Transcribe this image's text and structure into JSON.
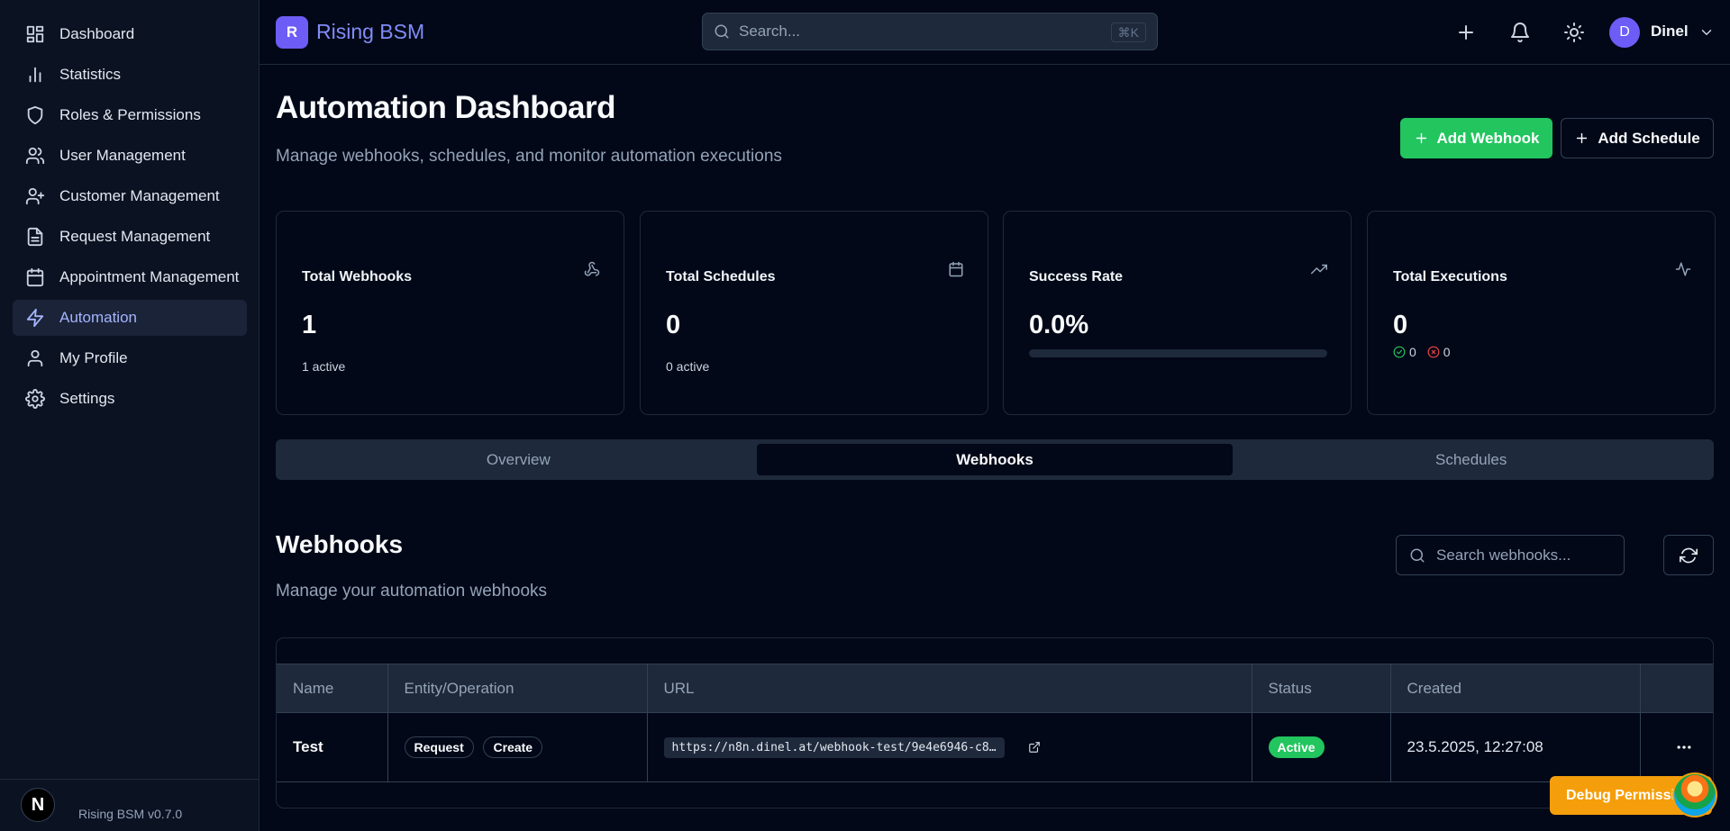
{
  "sidebar": {
    "items": [
      {
        "label": "Dashboard",
        "icon": "layout-grid-icon"
      },
      {
        "label": "Statistics",
        "icon": "bar-chart-icon"
      },
      {
        "label": "Roles & Permissions",
        "icon": "shield-icon"
      },
      {
        "label": "User Management",
        "icon": "users-icon"
      },
      {
        "label": "Customer Management",
        "icon": "user-plus-icon"
      },
      {
        "label": "Request Management",
        "icon": "file-text-icon"
      },
      {
        "label": "Appointment Management",
        "icon": "calendar-icon"
      },
      {
        "label": "Automation",
        "icon": "zap-icon"
      },
      {
        "label": "My Profile",
        "icon": "user-icon"
      },
      {
        "label": "Settings",
        "icon": "settings-icon"
      }
    ],
    "footer_badge": "N",
    "version": "Rising BSM v0.7.0"
  },
  "header": {
    "logo_letter": "R",
    "brand": "Rising BSM",
    "search_placeholder": "Search...",
    "search_shortcut": "⌘K",
    "avatar_letter": "D",
    "username": "Dinel"
  },
  "page": {
    "title": "Automation Dashboard",
    "subtitle": "Manage webhooks, schedules, and monitor automation executions",
    "add_webhook_label": "Add Webhook",
    "add_schedule_label": "Add Schedule"
  },
  "stats": {
    "webhooks": {
      "title": "Total Webhooks",
      "value": "1",
      "note": "1 active",
      "icon": "webhook-icon"
    },
    "schedules": {
      "title": "Total Schedules",
      "value": "0",
      "note": "0 active",
      "icon": "calendar-icon"
    },
    "success": {
      "title": "Success Rate",
      "value": "0.0%",
      "progress": 0,
      "icon": "trending-up-icon"
    },
    "executions": {
      "title": "Total Executions",
      "value": "0",
      "success_count": "0",
      "failed_count": "0",
      "icon": "activity-icon"
    }
  },
  "tabs": [
    {
      "label": "Overview",
      "active": false
    },
    {
      "label": "Webhooks",
      "active": true
    },
    {
      "label": "Schedules",
      "active": false
    }
  ],
  "webhooks_section": {
    "title": "Webhooks",
    "subtitle": "Manage your automation webhooks",
    "search_placeholder": "Search webhooks...",
    "columns": [
      "Name",
      "Entity/Operation",
      "URL",
      "Status",
      "Created",
      ""
    ],
    "rows": [
      {
        "name": "Test",
        "entity": "Request",
        "operation": "Create",
        "url": "https://n8n.dinel.at/webhook-test/9e4e6946-c8…",
        "status": "Active",
        "created": "23.5.2025, 12:27:08"
      }
    ]
  },
  "debug": {
    "label": "Debug Permissions"
  },
  "colors": {
    "accent": "#818cf8",
    "success": "#22c55e",
    "warning": "#f59e0b",
    "danger": "#ef4444",
    "background": "#020817"
  }
}
